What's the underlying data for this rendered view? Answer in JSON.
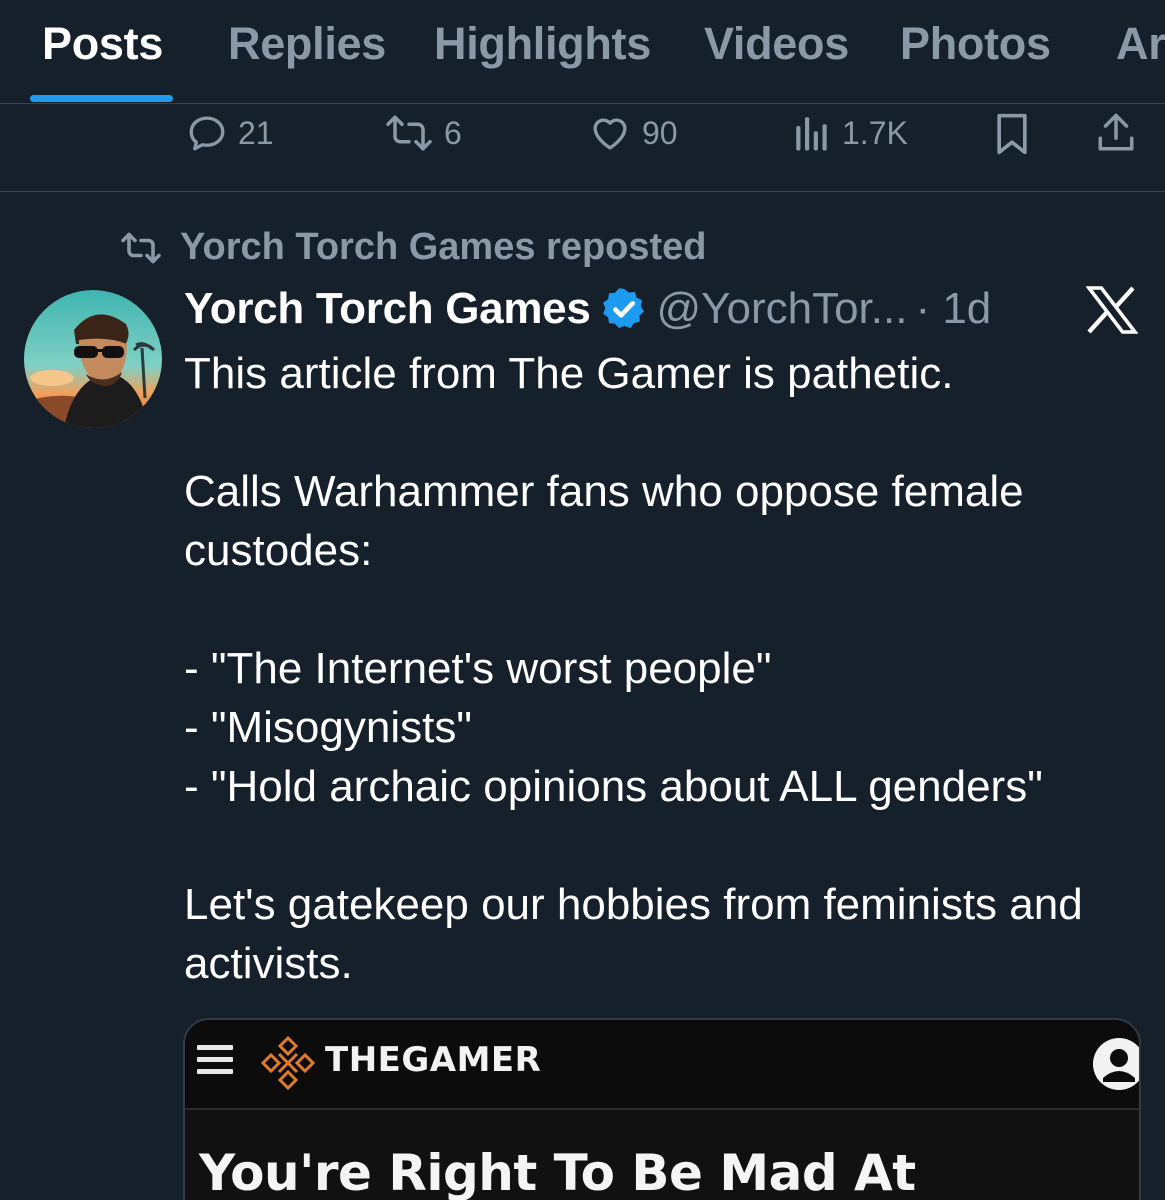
{
  "tabs": [
    {
      "label": "Posts",
      "active": true
    },
    {
      "label": "Replies",
      "active": false
    },
    {
      "label": "Highlights",
      "active": false
    },
    {
      "label": "Videos",
      "active": false
    },
    {
      "label": "Photos",
      "active": false
    },
    {
      "label": "Ar",
      "active": false
    }
  ],
  "prev_post_actions": {
    "replies": "21",
    "reposts": "6",
    "likes": "90",
    "views": "1.7K"
  },
  "post": {
    "repost_label": "Yorch Torch Games reposted",
    "author_name": "Yorch Torch Games",
    "handle": "@YorchTor...",
    "time": "· 1d",
    "verified": true,
    "lines": [
      "This article from The Gamer is pathetic.",
      "",
      "Calls Warhammer fans who oppose female custodes:",
      "",
      "- \"The Internet's worst people\"\n- \"Misogynists\"\n- \"Hold archaic opinions about ALL genders\"",
      "",
      "Let's gatekeep our hobbies from feminists and activists."
    ],
    "card": {
      "site_name": "THEGAMER",
      "headline": "You're Right To Be Mad At"
    }
  },
  "colors": {
    "background": "#15202b",
    "accent": "#1d9bf0",
    "muted": "#8b98a5",
    "verified": "#1d9bf0"
  }
}
